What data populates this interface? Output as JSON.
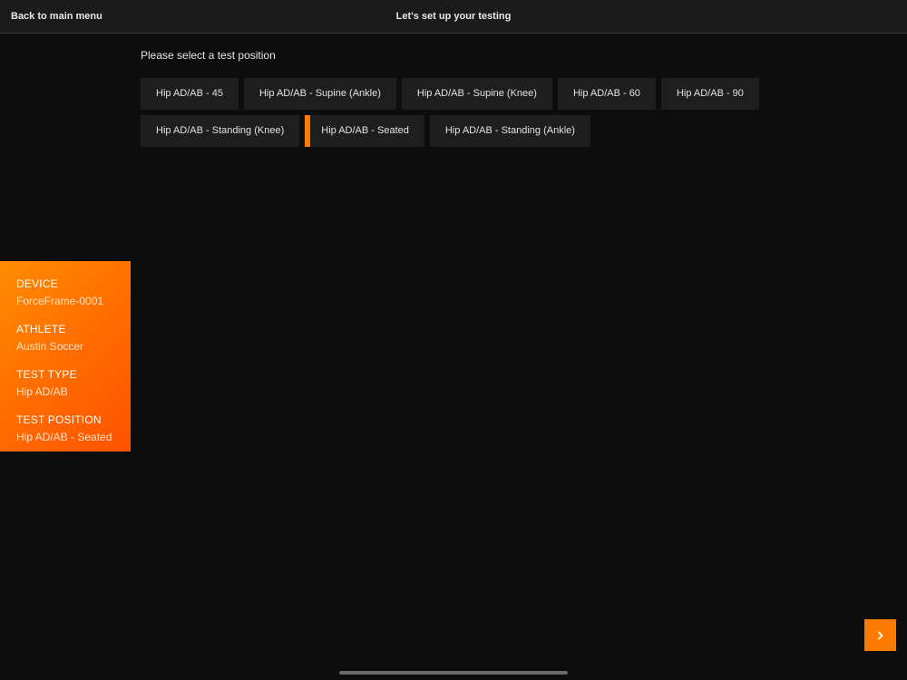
{
  "topbar": {
    "back_label": "Back to main menu",
    "title": "Let's set up your testing"
  },
  "prompt": "Please select a test position",
  "options": [
    {
      "label": "Hip AD/AB - 45",
      "selected": false
    },
    {
      "label": "Hip AD/AB - Supine (Ankle)",
      "selected": false
    },
    {
      "label": "Hip AD/AB - Supine (Knee)",
      "selected": false
    },
    {
      "label": "Hip AD/AB - 60",
      "selected": false
    },
    {
      "label": "Hip AD/AB - 90",
      "selected": false
    },
    {
      "label": "Hip AD/AB - Standing (Knee)",
      "selected": false
    },
    {
      "label": "Hip AD/AB - Seated",
      "selected": true
    },
    {
      "label": "Hip AD/AB - Standing (Ankle)",
      "selected": false
    }
  ],
  "summary": {
    "device_label": "DEVICE",
    "device_value": "ForceFrame-0001",
    "athlete_label": "ATHLETE",
    "athlete_value": "Austin Soccer",
    "test_type_label": "TEST TYPE",
    "test_type_value": "Hip AD/AB",
    "test_position_label": "TEST POSITION",
    "test_position_value": "Hip AD/AB - Seated"
  },
  "next_button": {
    "icon": "chevron-right-icon"
  },
  "colors": {
    "accent": "#ff7a00",
    "background": "#0d0d0d",
    "topbar": "#1b1b1b",
    "option_bg": "#1e1e1e"
  }
}
